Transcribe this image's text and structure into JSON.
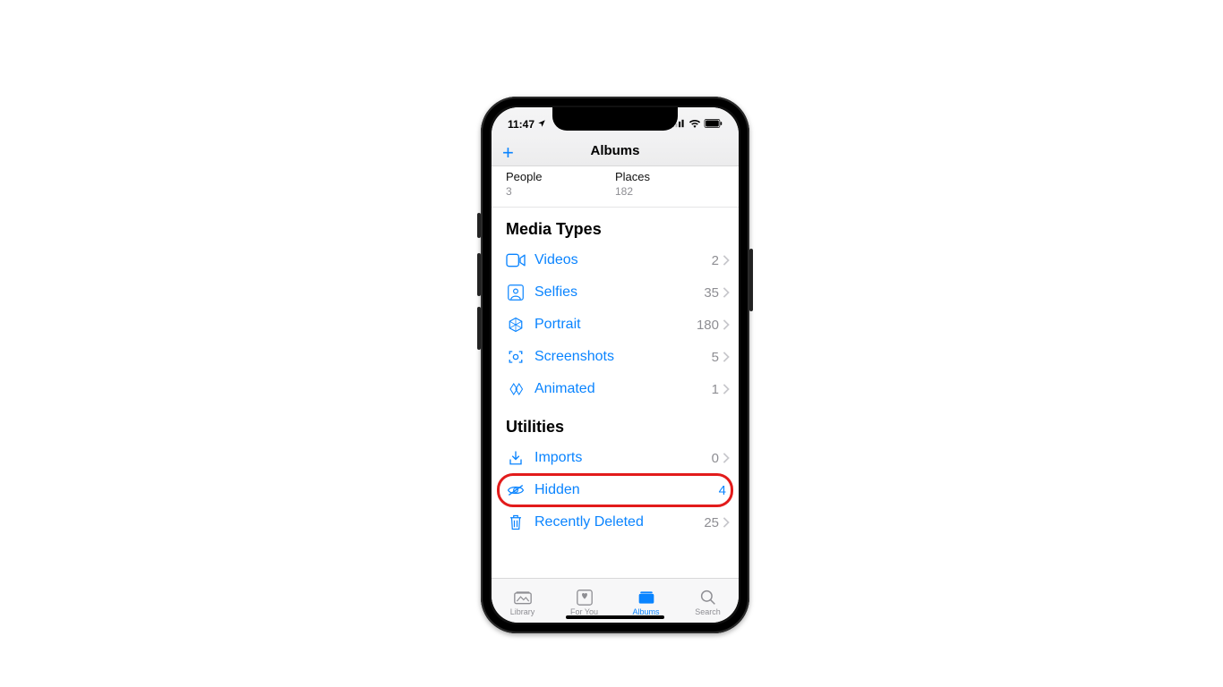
{
  "status": {
    "time": "11:47",
    "location_icon": "location-arrow",
    "signal_icon": "cellular-bars",
    "wifi_icon": "wifi",
    "battery_icon": "battery"
  },
  "nav": {
    "title": "Albums",
    "add_label": "+"
  },
  "people_places": {
    "col1": {
      "label": "People",
      "count": "3"
    },
    "col2": {
      "label": "Places",
      "count": "182"
    }
  },
  "sections": [
    {
      "header": "Media Types",
      "rows": [
        {
          "icon": "video",
          "label": "Videos",
          "count": "2",
          "chevron": true
        },
        {
          "icon": "selfie",
          "label": "Selfies",
          "count": "35",
          "chevron": true
        },
        {
          "icon": "portrait",
          "label": "Portrait",
          "count": "180",
          "chevron": true
        },
        {
          "icon": "screenshot",
          "label": "Screenshots",
          "count": "5",
          "chevron": true
        },
        {
          "icon": "animated",
          "label": "Animated",
          "count": "1",
          "chevron": true
        }
      ]
    },
    {
      "header": "Utilities",
      "rows": [
        {
          "icon": "imports",
          "label": "Imports",
          "count": "0",
          "chevron": true
        },
        {
          "icon": "hidden",
          "label": "Hidden",
          "count": "4",
          "chevron": false,
          "highlighted": true
        },
        {
          "icon": "trash",
          "label": "Recently Deleted",
          "count": "25",
          "chevron": true
        }
      ]
    }
  ],
  "tabs": [
    {
      "icon": "library",
      "label": "Library",
      "active": false
    },
    {
      "icon": "foryou",
      "label": "For You",
      "active": false
    },
    {
      "icon": "albums",
      "label": "Albums",
      "active": true
    },
    {
      "icon": "search",
      "label": "Search",
      "active": false
    }
  ],
  "annotation": {
    "highlight_row_label": "Hidden",
    "highlight_color": "#e21b1b"
  }
}
